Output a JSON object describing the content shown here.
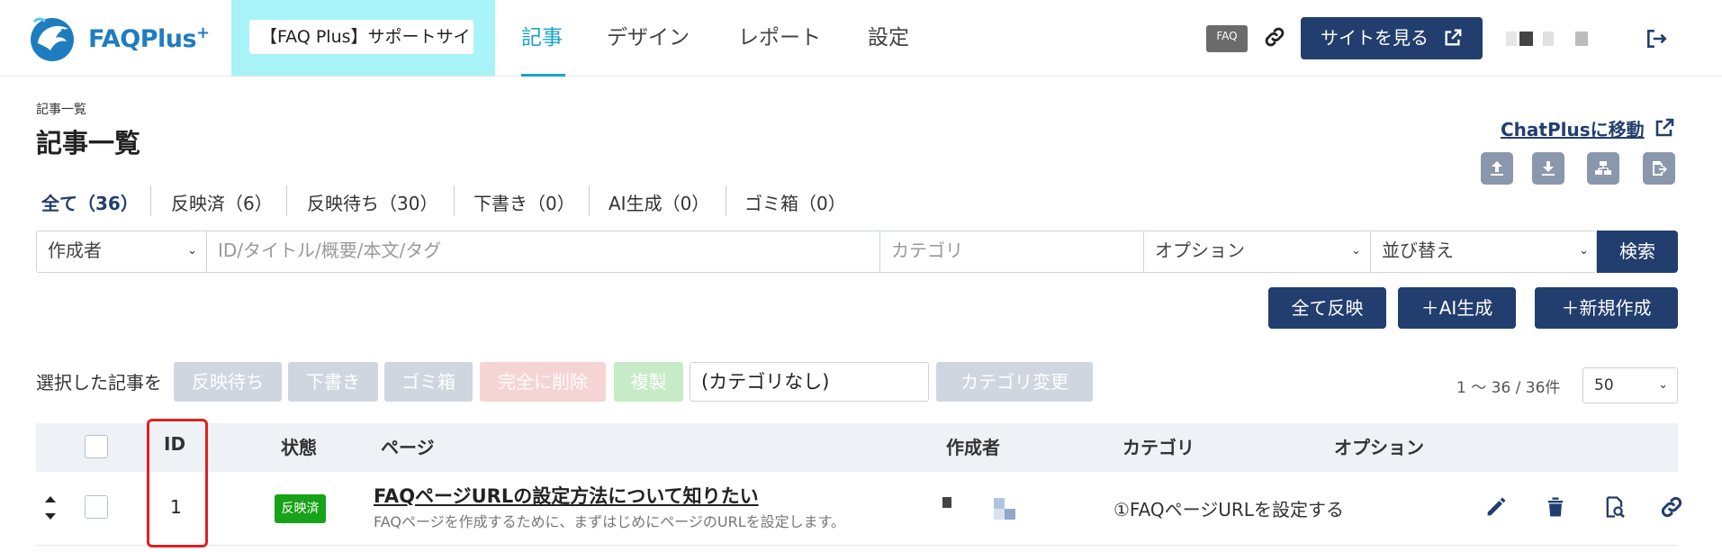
{
  "header": {
    "logo_text": "FAQPlus",
    "logo_plus": "+",
    "site_selector": "【FAQ Plus】サポートサイト",
    "nav": [
      "記事",
      "デザイン",
      "レポート",
      "設定"
    ],
    "active_nav": "記事",
    "faq_icon_label": "FAQ",
    "view_site_label": "サイトを見る",
    "accent_color": "#1aa3c8",
    "primary_color": "#223e6e"
  },
  "page": {
    "breadcrumb": "記事一覧",
    "title": "記事一覧",
    "chatplus_link": "ChatPlusに移動"
  },
  "filter_tabs": [
    {
      "label": "全て（36）"
    },
    {
      "label": "反映済（6）"
    },
    {
      "label": "反映待ち（30）"
    },
    {
      "label": "下書き（0）"
    },
    {
      "label": "AI生成（0）"
    },
    {
      "label": "ゴミ箱（0）"
    }
  ],
  "search": {
    "author_select": "作成者",
    "keyword_placeholder": "ID/タイトル/概要/本文/タグ",
    "category_placeholder": "カテゴリ",
    "option_select": "オプション",
    "sort_select": "並び替え",
    "search_button": "検索"
  },
  "actions": {
    "publish_all": "全て反映",
    "ai_generate": "＋AI生成",
    "new_create": "＋新規作成"
  },
  "bulk": {
    "label": "選択した記事を",
    "buttons": [
      "反映待ち",
      "下書き",
      "ゴミ箱",
      "完全に削除",
      "複製"
    ],
    "category_value": "(カテゴリなし)",
    "category_change": "カテゴリ変更"
  },
  "pagination": {
    "count_text": "1 ～ 36 / 36件",
    "per_page": "50"
  },
  "table": {
    "headers": [
      "ID",
      "状態",
      "ページ",
      "作成者",
      "カテゴリ",
      "オプション"
    ],
    "rows": [
      {
        "id": "1",
        "status": "反映済",
        "title": "FAQページURLの設定方法について知りたい",
        "description": "FAQページを作成するために、まずはじめにページのURLを設定します。",
        "category": "①FAQページURLを設定する"
      }
    ]
  }
}
